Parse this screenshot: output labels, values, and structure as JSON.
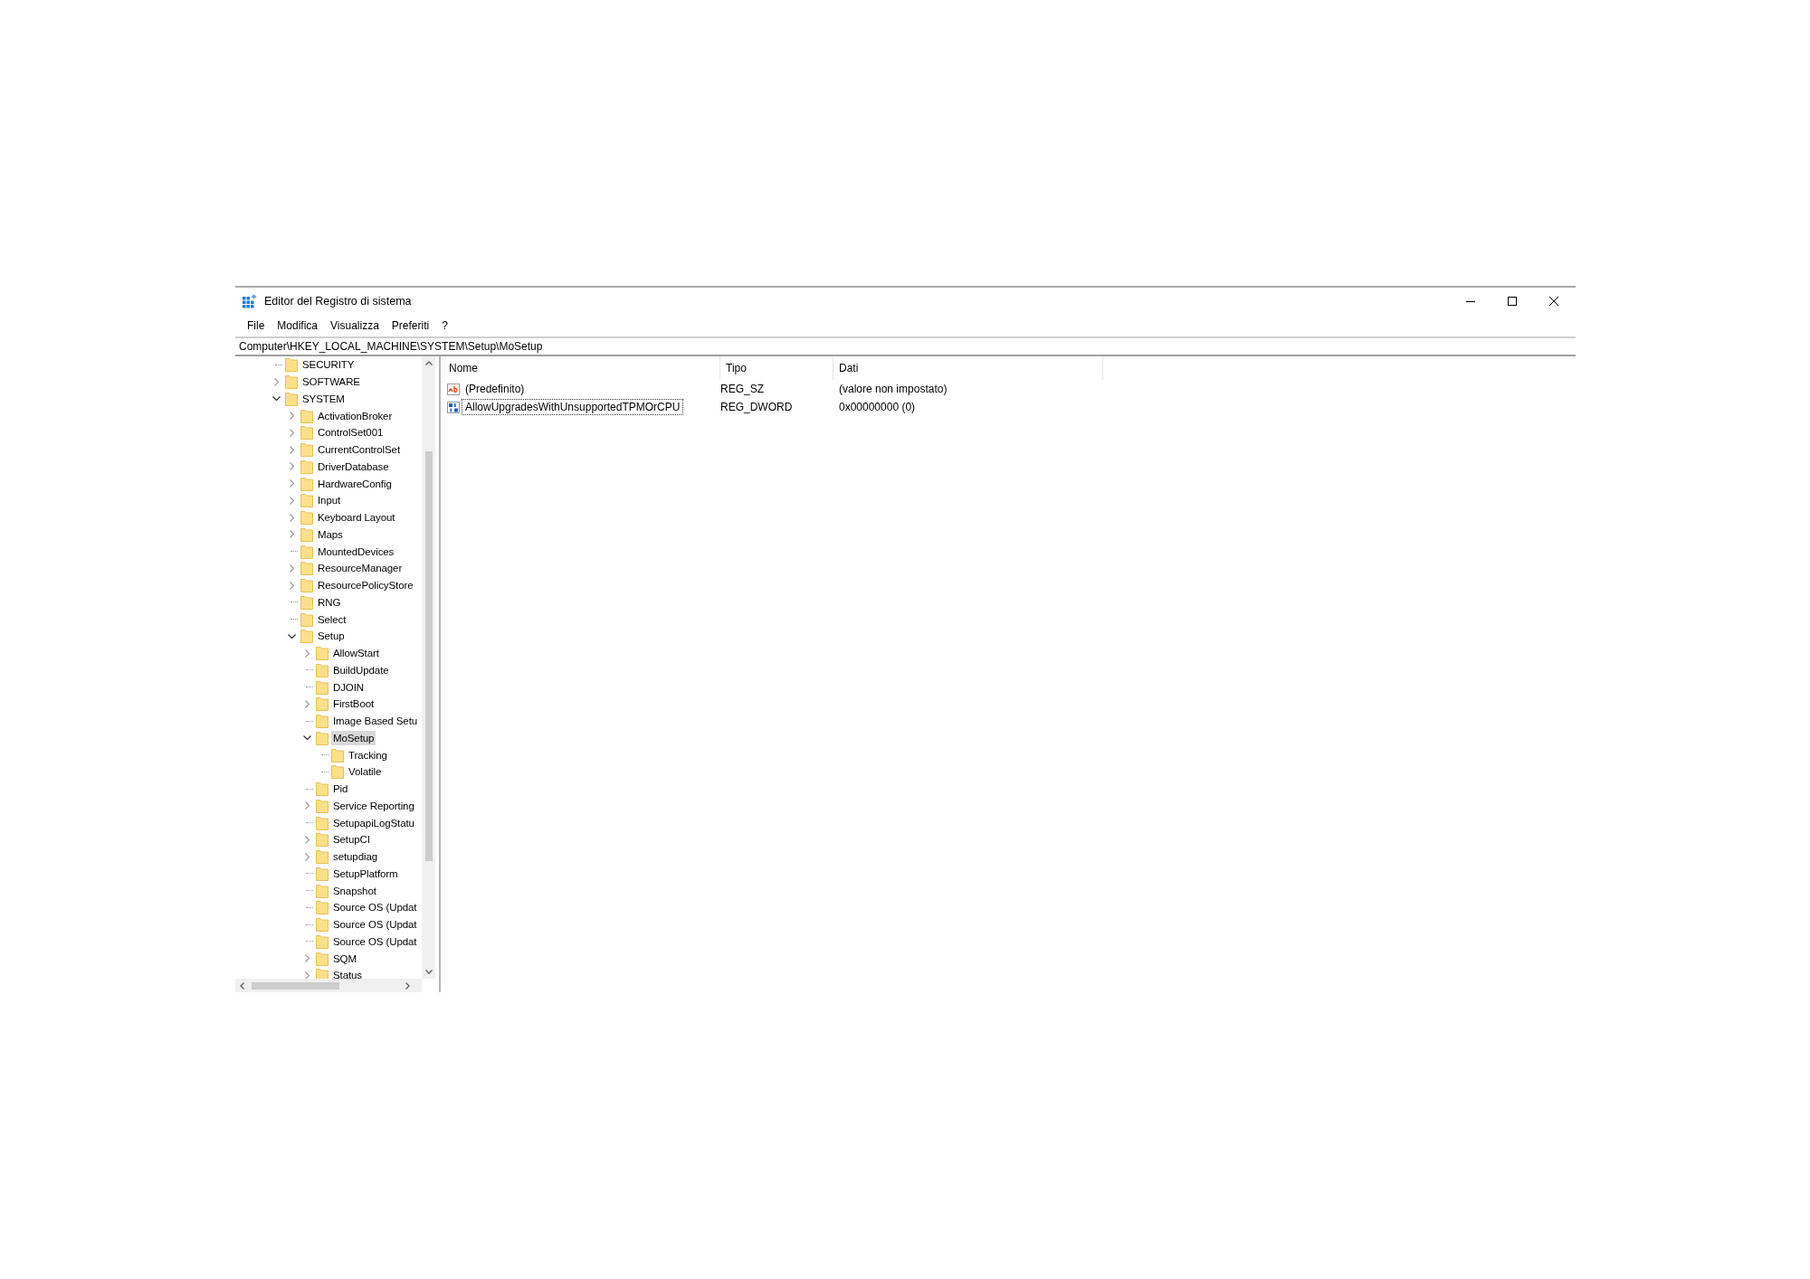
{
  "window": {
    "title": "Editor del Registro di sistema"
  },
  "menu": [
    "File",
    "Modifica",
    "Visualizza",
    "Preferiti",
    "?"
  ],
  "address": "Computer\\HKEY_LOCAL_MACHINE\\SYSTEM\\Setup\\MoSetup",
  "tree": [
    {
      "label": "SECURITY",
      "kind": "leaf",
      "selected": false
    },
    {
      "label": "SOFTWARE",
      "kind": "branch",
      "expanded": false,
      "selected": false
    },
    {
      "label": "SYSTEM",
      "kind": "branch",
      "expanded": true,
      "selected": false,
      "children": [
        {
          "label": "ActivationBroker",
          "kind": "branch",
          "expanded": false,
          "selected": false
        },
        {
          "label": "ControlSet001",
          "kind": "branch",
          "expanded": false,
          "selected": false
        },
        {
          "label": "CurrentControlSet",
          "kind": "branch",
          "expanded": false,
          "selected": false
        },
        {
          "label": "DriverDatabase",
          "kind": "branch",
          "expanded": false,
          "selected": false
        },
        {
          "label": "HardwareConfig",
          "kind": "branch",
          "expanded": false,
          "selected": false
        },
        {
          "label": "Input",
          "kind": "branch",
          "expanded": false,
          "selected": false
        },
        {
          "label": "Keyboard Layout",
          "kind": "branch",
          "expanded": false,
          "selected": false
        },
        {
          "label": "Maps",
          "kind": "branch",
          "expanded": false,
          "selected": false
        },
        {
          "label": "MountedDevices",
          "kind": "leaf",
          "selected": false
        },
        {
          "label": "ResourceManager",
          "kind": "branch",
          "expanded": false,
          "selected": false
        },
        {
          "label": "ResourcePolicyStore",
          "kind": "branch",
          "expanded": false,
          "selected": false
        },
        {
          "label": "RNG",
          "kind": "leaf",
          "selected": false
        },
        {
          "label": "Select",
          "kind": "leaf",
          "selected": false
        },
        {
          "label": "Setup",
          "kind": "branch",
          "expanded": true,
          "selected": false,
          "children": [
            {
              "label": "AllowStart",
              "kind": "branch",
              "expanded": false,
              "selected": false
            },
            {
              "label": "BuildUpdate",
              "kind": "leaf",
              "selected": false
            },
            {
              "label": "DJOIN",
              "kind": "leaf",
              "selected": false
            },
            {
              "label": "FirstBoot",
              "kind": "branch",
              "expanded": false,
              "selected": false
            },
            {
              "label": "Image Based Setu",
              "kind": "leaf",
              "selected": false
            },
            {
              "label": "MoSetup",
              "kind": "branch",
              "expanded": true,
              "selected": true,
              "children": [
                {
                  "label": "Tracking",
                  "kind": "leaf",
                  "selected": false
                },
                {
                  "label": "Volatile",
                  "kind": "leaf",
                  "selected": false
                }
              ]
            },
            {
              "label": "Pid",
              "kind": "leaf",
              "selected": false
            },
            {
              "label": "Service Reporting",
              "kind": "branch",
              "expanded": false,
              "selected": false
            },
            {
              "label": "SetupapiLogStatu",
              "kind": "leaf",
              "selected": false
            },
            {
              "label": "SetupCI",
              "kind": "branch",
              "expanded": false,
              "selected": false
            },
            {
              "label": "setupdiag",
              "kind": "branch",
              "expanded": false,
              "selected": false
            },
            {
              "label": "SetupPlatform",
              "kind": "leaf",
              "selected": false
            },
            {
              "label": "Snapshot",
              "kind": "leaf",
              "selected": false
            },
            {
              "label": "Source OS (Updat",
              "kind": "leaf",
              "selected": false
            },
            {
              "label": "Source OS (Updat",
              "kind": "leaf",
              "selected": false
            },
            {
              "label": "Source OS (Updat",
              "kind": "leaf",
              "selected": false
            },
            {
              "label": "SQM",
              "kind": "branch",
              "expanded": false,
              "selected": false
            },
            {
              "label": "Status",
              "kind": "branch",
              "expanded": false,
              "selected": false
            }
          ]
        }
      ]
    }
  ],
  "values": {
    "columns": [
      "Nome",
      "Tipo",
      "Dati"
    ],
    "rows": [
      {
        "kind": "string",
        "name": "(Predefinito)",
        "type": "REG_SZ",
        "data": "(valore non impostato)",
        "focused": false
      },
      {
        "kind": "dword",
        "name": "AllowUpgradesWithUnsupportedTPMOrCPU",
        "type": "REG_DWORD",
        "data": "0x00000000 (0)",
        "focused": true
      }
    ]
  }
}
